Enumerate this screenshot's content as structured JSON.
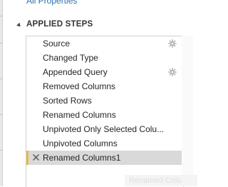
{
  "properties_link": "All Properties",
  "applied_steps": {
    "title": "APPLIED STEPS",
    "steps": [
      {
        "label": "Source",
        "has_settings": true
      },
      {
        "label": "Changed Type",
        "has_settings": false
      },
      {
        "label": "Appended Query",
        "has_settings": true
      },
      {
        "label": "Removed Columns",
        "has_settings": false
      },
      {
        "label": "Sorted Rows",
        "has_settings": false
      },
      {
        "label": "Renamed Columns",
        "has_settings": false
      },
      {
        "label": "Unpivoted Only Selected Colu...",
        "has_settings": false
      },
      {
        "label": "Unpivoted Columns",
        "has_settings": false
      },
      {
        "label": "Renamed Columns1",
        "has_settings": false,
        "selected": true
      }
    ]
  },
  "ghost_text": "Renamed Colu",
  "colors": {
    "link": "#2b6cb0",
    "selected_background": "#d9d9d9",
    "selected_marker": "#e6b84c",
    "gear": "#b5b5b5"
  },
  "icons": {
    "collapse": "collapse-triangle-icon",
    "settings": "gear-icon",
    "delete": "close-icon"
  }
}
